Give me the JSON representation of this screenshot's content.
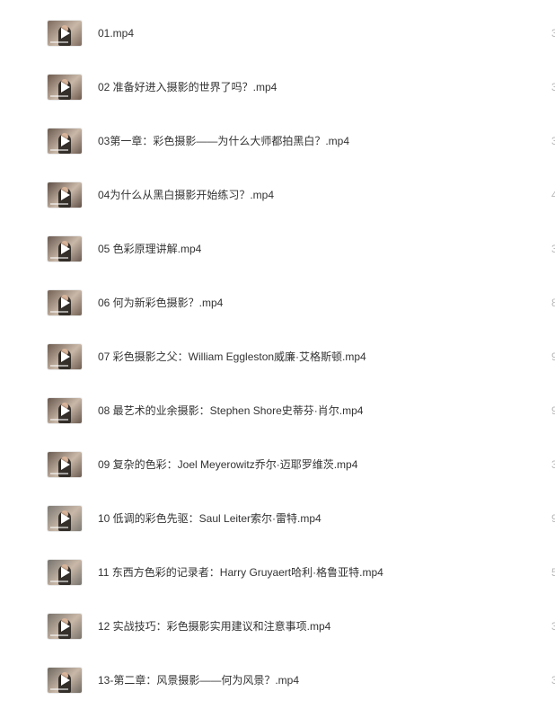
{
  "files": [
    {
      "name": "01.mp4",
      "icon": "video-play-icon",
      "thumb_color": "#7d6a5e",
      "edge": "3"
    },
    {
      "name": "02 准备好进入摄影的世界了吗？.mp4",
      "icon": "video-play-icon",
      "thumb_color": "#6e5a4e",
      "edge": "3"
    },
    {
      "name": "03第一章：彩色摄影——为什么大师都拍黑白？.mp4",
      "icon": "video-play-icon",
      "thumb_color": "#6b5a50",
      "edge": "3"
    },
    {
      "name": "04为什么从黑白摄影开始练习？.mp4",
      "icon": "video-play-icon",
      "thumb_color": "#5f4f46",
      "edge": "4"
    },
    {
      "name": "05 色彩原理讲解.mp4",
      "icon": "video-play-icon",
      "thumb_color": "#6a5a52",
      "edge": "3"
    },
    {
      "name": "06 何为新彩色摄影？.mp4",
      "icon": "video-play-icon",
      "thumb_color": "#736255",
      "edge": "8"
    },
    {
      "name": "07 彩色摄影之父：William Eggleston威廉·艾格斯顿.mp4",
      "icon": "video-play-icon",
      "thumb_color": "#6d5c50",
      "edge": "9"
    },
    {
      "name": "08 最艺术的业余摄影：Stephen Shore史蒂芬·肖尔.mp4",
      "icon": "video-play-icon",
      "thumb_color": "#68584e",
      "edge": "9"
    },
    {
      "name": "09 复杂的色彩：Joel Meyerowitz乔尔·迈耶罗维茨.mp4",
      "icon": "video-play-icon",
      "thumb_color": "#6a5b51",
      "edge": "3"
    },
    {
      "name": "10 低调的彩色先驱：Saul Leiter索尔·雷特.mp4",
      "icon": "video-play-icon",
      "thumb_color": "#7d7a74",
      "edge": "9"
    },
    {
      "name": "11 东西方色彩的记录者：Harry Gruyaert哈利·格鲁亚特.mp4",
      "icon": "video-play-icon",
      "thumb_color": "#76736e",
      "edge": "5"
    },
    {
      "name": "12 实战技巧：彩色摄影实用建议和注意事项.mp4",
      "icon": "video-play-icon",
      "thumb_color": "#7a736b",
      "edge": "3"
    },
    {
      "name": "13-第二章：风景摄影——何为风景？.mp4",
      "icon": "video-play-icon",
      "thumb_color": "#6f6860",
      "edge": "3"
    }
  ]
}
